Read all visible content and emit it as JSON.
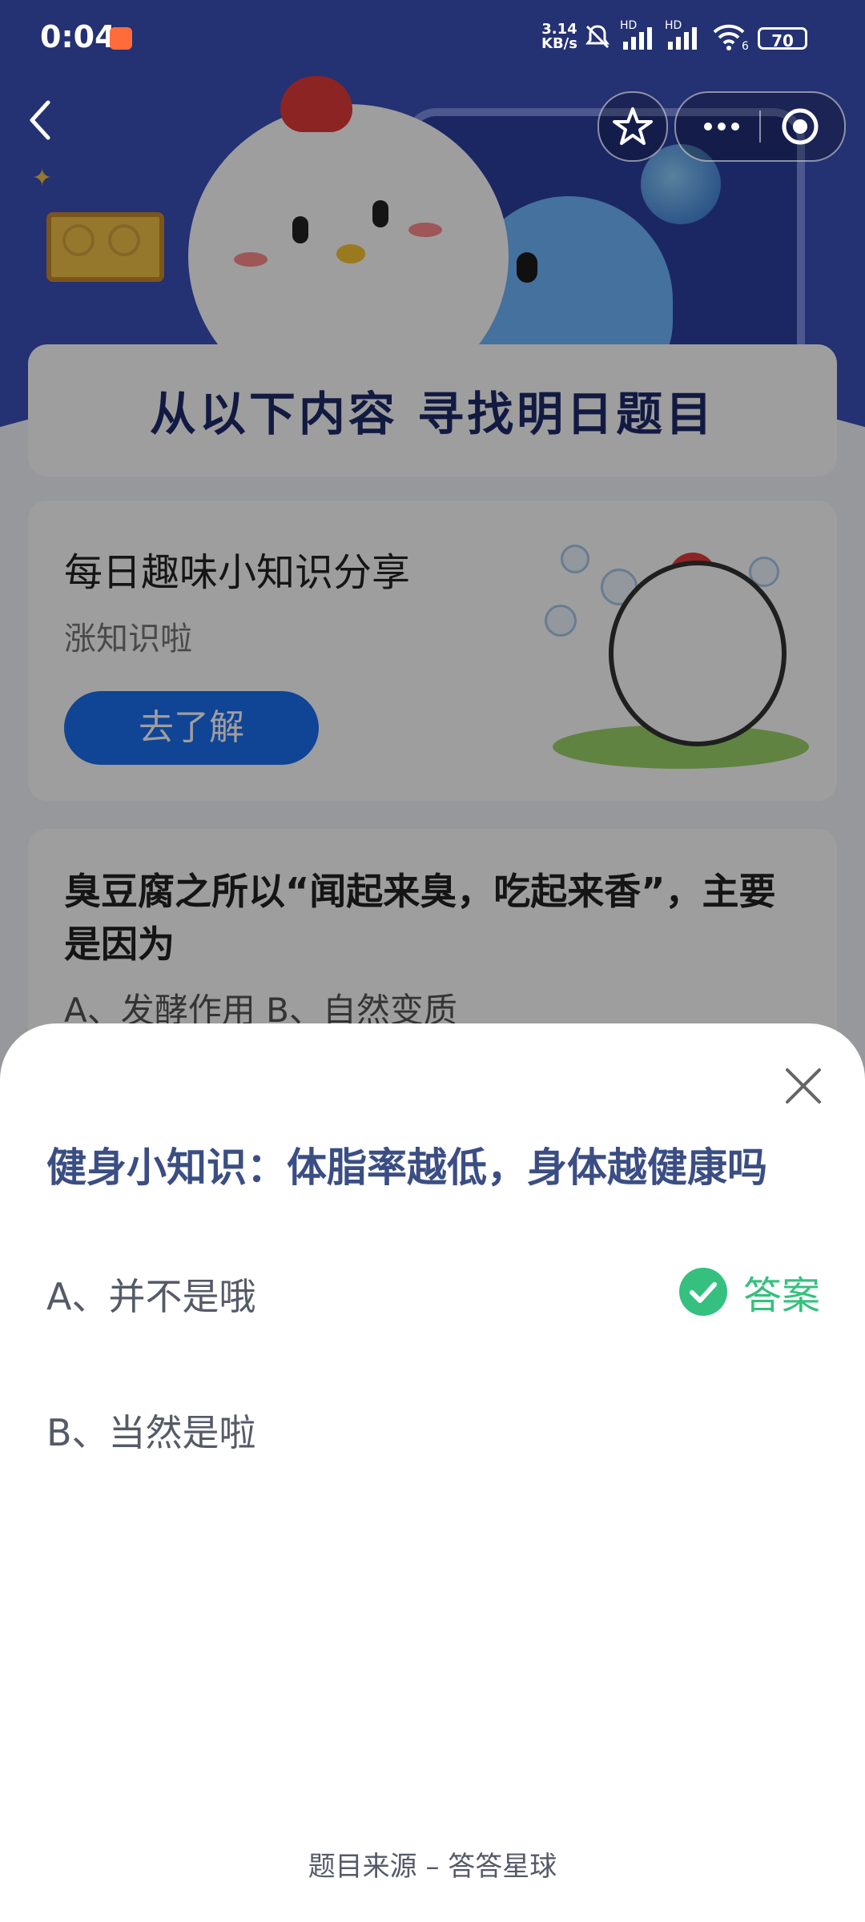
{
  "status_bar": {
    "time": "0:04",
    "net_speed_value": "3.14",
    "net_speed_unit": "KB/s",
    "signal_hd": "HD",
    "wifi_sub": "6",
    "battery": "70"
  },
  "background": {
    "panel_title": "从以下内容 寻找明日题目",
    "card1": {
      "title": "每日趣味小知识分享",
      "subtitle": "涨知识啦",
      "button": "去了解"
    },
    "card2": {
      "question": "臭豆腐之所以“闻起来臭，吃起来香”，主要是因为",
      "options_preview": "A、发酵作用    B、自然变质"
    }
  },
  "sheet": {
    "question": "健身小知识：体脂率越低，身体越健康吗",
    "options": [
      {
        "label": "A、并不是哦",
        "is_answer": true
      },
      {
        "label": "B、当然是啦",
        "is_answer": false
      }
    ],
    "answer_label": "答案",
    "source": "题目来源 – 答答星球"
  },
  "colors": {
    "accent_green": "#35c07f",
    "question_blue": "#3b4e84",
    "button_blue": "#1a6ef0"
  },
  "icons": {
    "back": "chevron-left-icon",
    "favorite": "star-icon",
    "more": "more-dots-icon",
    "target": "target-icon",
    "close": "close-icon",
    "check": "check-circle-icon"
  }
}
